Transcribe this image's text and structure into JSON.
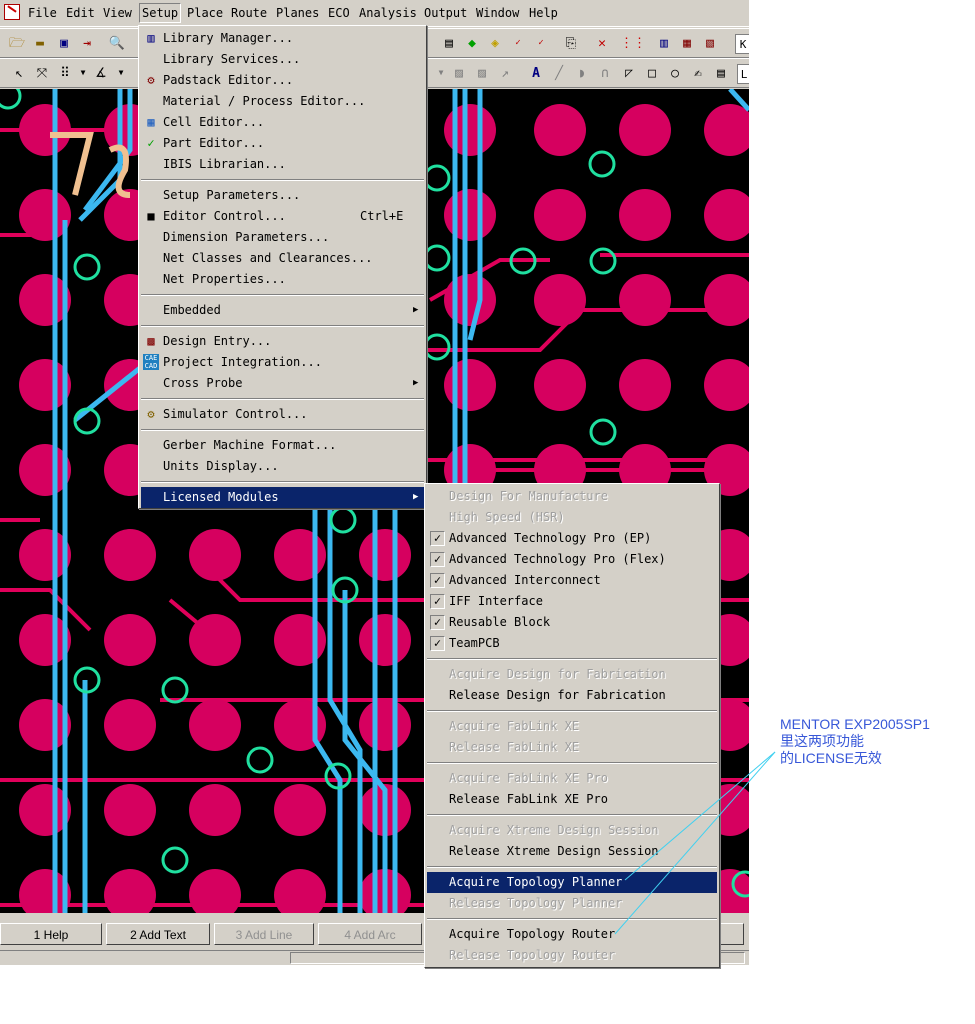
{
  "menubar": {
    "items": [
      "File",
      "Edit",
      "View",
      "Setup",
      "Place",
      "Route",
      "Planes",
      "ECO",
      "Analysis",
      "Output",
      "Window",
      "Help"
    ],
    "active": "Setup"
  },
  "setup_menu": {
    "group1": [
      {
        "label": "Library Manager...",
        "icon": "library-icon"
      },
      {
        "label": "Library Services...",
        "icon": ""
      },
      {
        "label": "Padstack Editor...",
        "icon": "padstack-icon"
      },
      {
        "label": "Material / Process Editor...",
        "icon": ""
      },
      {
        "label": "Cell Editor...",
        "icon": "cell-icon"
      },
      {
        "label": "Part Editor...",
        "icon": "part-icon"
      },
      {
        "label": "IBIS Librarian...",
        "icon": ""
      }
    ],
    "group2": [
      {
        "label": "Setup Parameters...",
        "shortcut": ""
      },
      {
        "label": "Editor Control...",
        "shortcut": "Ctrl+E"
      },
      {
        "label": "Dimension Parameters...",
        "shortcut": ""
      },
      {
        "label": "Net Classes and Clearances...",
        "shortcut": ""
      },
      {
        "label": "Net Properties...",
        "shortcut": ""
      }
    ],
    "embedded": "Embedded",
    "group4": [
      {
        "label": "Design Entry..."
      },
      {
        "label": "Project Integration..."
      },
      {
        "label": "Cross Probe"
      }
    ],
    "simulator": "Simulator Control...",
    "group6": [
      "Gerber Machine Format...",
      "Units Display..."
    ],
    "licensed": "Licensed Modules",
    "icon_texts": {
      "cae": "CAE",
      "cad": "CAD"
    }
  },
  "licensed_menu": {
    "items": [
      {
        "label": "Design For Manufacture",
        "disabled": true,
        "checked": false,
        "sep_after": false
      },
      {
        "label": "High Speed (HSR)",
        "disabled": true,
        "checked": false,
        "sep_after": false
      },
      {
        "label": "Advanced Technology Pro (EP)",
        "disabled": false,
        "checked": true,
        "sep_after": false
      },
      {
        "label": "Advanced Technology Pro (Flex)",
        "disabled": false,
        "checked": true,
        "sep_after": false
      },
      {
        "label": "Advanced Interconnect",
        "disabled": false,
        "checked": true,
        "sep_after": false
      },
      {
        "label": "IFF Interface",
        "disabled": false,
        "checked": true,
        "sep_after": false
      },
      {
        "label": "Reusable Block",
        "disabled": false,
        "checked": true,
        "sep_after": false
      },
      {
        "label": "TeamPCB",
        "disabled": false,
        "checked": true,
        "sep_after": true
      },
      {
        "label": "Acquire Design for Fabrication",
        "disabled": true,
        "sep_after": false
      },
      {
        "label": "Release Design for Fabrication",
        "disabled": false,
        "sep_after": true
      },
      {
        "label": "Acquire FabLink XE",
        "disabled": true,
        "sep_after": false
      },
      {
        "label": "Release FabLink XE",
        "disabled": true,
        "sep_after": true
      },
      {
        "label": "Acquire FabLink XE Pro",
        "disabled": true,
        "sep_after": false
      },
      {
        "label": "Release FabLink XE Pro",
        "disabled": false,
        "sep_after": true
      },
      {
        "label": "Acquire Xtreme Design Session",
        "disabled": true,
        "sep_after": false
      },
      {
        "label": "Release Xtreme Design Session",
        "disabled": false,
        "sep_after": true
      },
      {
        "label": "Acquire Topology Planner",
        "disabled": false,
        "highlighted": true,
        "sep_after": false
      },
      {
        "label": "Release Topology Planner",
        "disabled": true,
        "sep_after": true
      },
      {
        "label": "Acquire Topology Router",
        "disabled": false,
        "sep_after": false
      },
      {
        "label": "Release Topology Router",
        "disabled": true,
        "sep_after": false
      }
    ],
    "check_glyph": "✓"
  },
  "function_keys": [
    {
      "label": "1 Help",
      "enabled": true
    },
    {
      "label": "2 Add Text",
      "enabled": true
    },
    {
      "label": "3 Add Line",
      "enabled": false
    },
    {
      "label": "4 Add Arc",
      "enabled": false
    }
  ],
  "toolbar_edge_labels": [
    "K",
    "L"
  ],
  "annotation": {
    "lines": [
      "MENTOR EXP2005SP1",
      "里这两项功能",
      "的LICENSE无效"
    ],
    "color": "#3858d8"
  },
  "colors": {
    "menu_bg": "#d4d0c8",
    "highlight": "#0a246a",
    "pcb_bg": "#000000",
    "pad": "#d6005f",
    "trace_red": "#e0005a",
    "trace_blue": "#3cb8f0",
    "via": "#20e0a0",
    "silkscreen": "#f0c090"
  }
}
